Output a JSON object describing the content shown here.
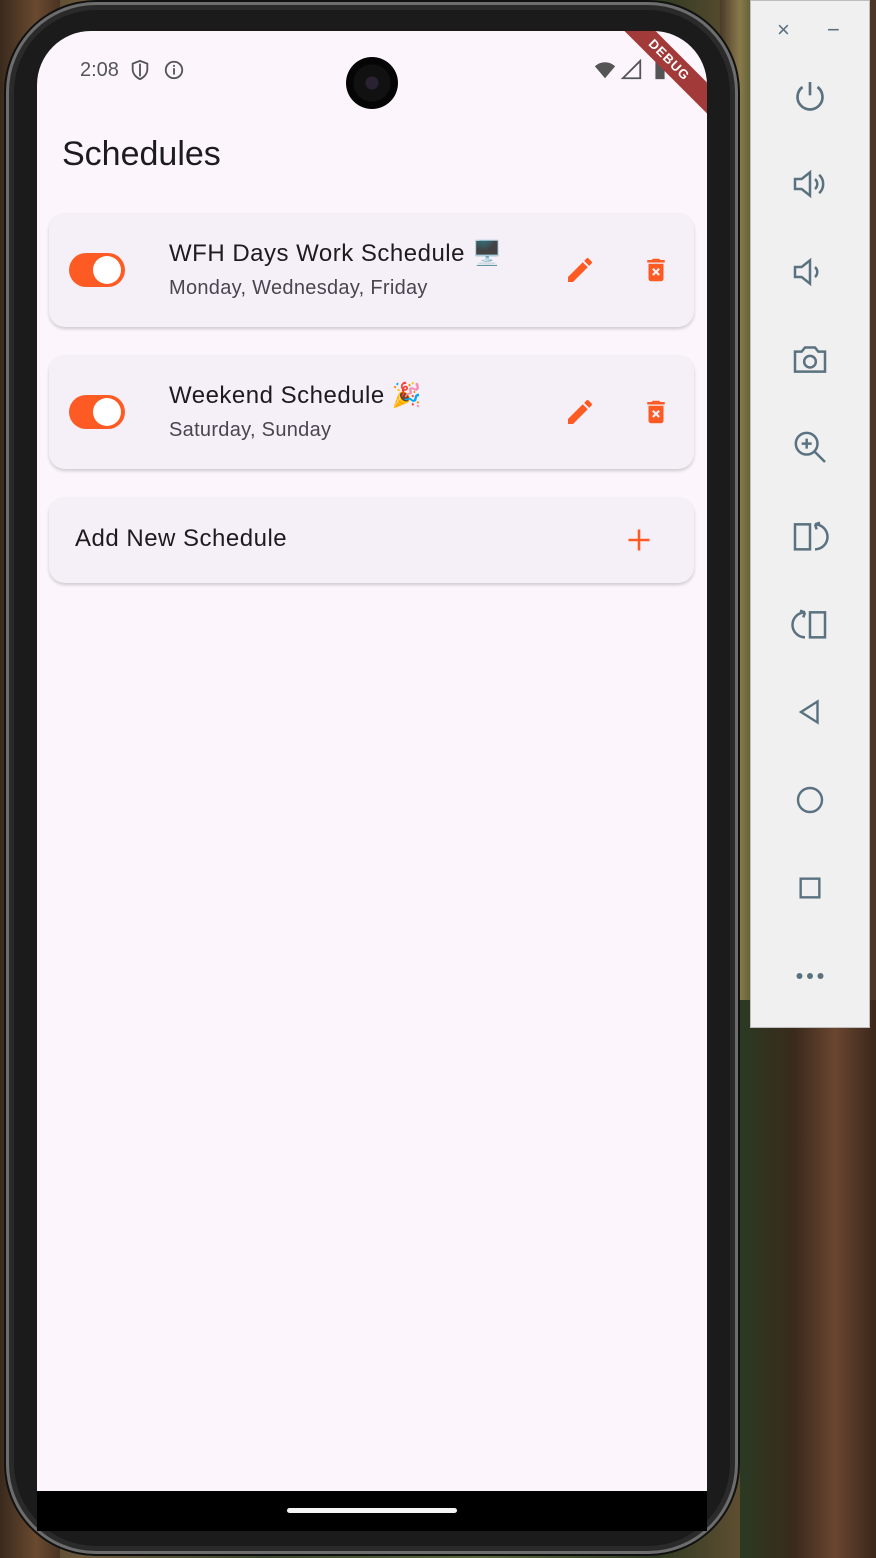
{
  "status_bar": {
    "time": "2:08",
    "debug_label": "DEBUG"
  },
  "page": {
    "title": "Schedules"
  },
  "schedules": [
    {
      "title": "WFH Days Work Schedule 🖥️",
      "days": "Monday, Wednesday, Friday",
      "enabled": true
    },
    {
      "title": "Weekend Schedule 🎉",
      "days": "Saturday, Sunday",
      "enabled": true
    }
  ],
  "add_schedule": {
    "label": "Add New Schedule"
  },
  "emulator_panel": {
    "close_label": "×",
    "minimize_label": "−",
    "buttons": [
      "power-icon",
      "volume-up-icon",
      "volume-down-icon",
      "camera-icon",
      "zoom-in-icon",
      "rotate-left-icon",
      "rotate-right-icon",
      "back-icon",
      "home-icon",
      "overview-icon",
      "more-icon"
    ]
  },
  "colors": {
    "accent": "#fe5b24",
    "background": "#fcf6fc",
    "card": "#f5eff7",
    "panel_icon": "#5a7180"
  }
}
